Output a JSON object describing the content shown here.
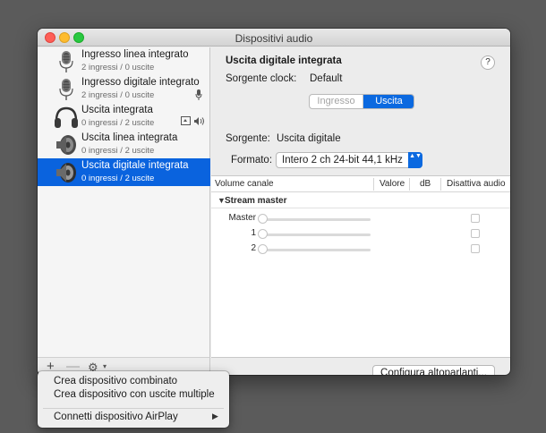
{
  "window": {
    "title": "Dispositivi audio"
  },
  "devices": [
    {
      "name": "Ingresso linea integrato",
      "io": "2 ingressi / 0 uscite",
      "icon": "microphone-icon"
    },
    {
      "name": "Ingresso digitale integrato",
      "io": "2 ingressi / 0 uscite",
      "icon": "microphone-icon"
    },
    {
      "name": "Uscita integrata",
      "io": "0 ingressi / 2 uscite",
      "icon": "headphones-icon"
    },
    {
      "name": "Uscita linea integrata",
      "io": "0 ingressi / 2 uscite",
      "icon": "speaker-icon"
    },
    {
      "name": "Uscita digitale integrata",
      "io": "0 ingressi / 2 uscite",
      "icon": "speaker-icon",
      "selected": true
    }
  ],
  "sidebar_footer": {
    "plus": "+",
    "minus": "—",
    "gear": "⚙",
    "chevron": "▾"
  },
  "detail": {
    "device_title": "Uscita digitale integrata",
    "help": "?",
    "clock_label": "Sorgente clock:",
    "clock_value": "Default",
    "tabs": {
      "input": "Ingresso",
      "output": "Uscita",
      "selected": "Uscita"
    },
    "source_label": "Sorgente:",
    "source_value": "Uscita digitale",
    "format_label": "Formato:",
    "format_value": "Intero 2 ch 24-bit 44,1 kHz",
    "format_arrows": "▲▼"
  },
  "table": {
    "headers": {
      "channel": "Volume canale",
      "value": "Valore",
      "db": "dB",
      "mute": "Disattiva audio"
    },
    "group": {
      "triangle": "▼",
      "label": "Stream master"
    },
    "channels": [
      "Master",
      "1",
      "2"
    ]
  },
  "configure_button": "Configura altoparlanti...",
  "context_menu": {
    "items": [
      "Crea dispositivo combinato",
      "Crea dispositivo con uscite multiple",
      "Connetti dispositivo AirPlay"
    ],
    "submenu_arrow": "▶"
  },
  "colors": {
    "accent": "#0b69e0",
    "selection": "#0a63de",
    "background": "#5b5b5b"
  }
}
